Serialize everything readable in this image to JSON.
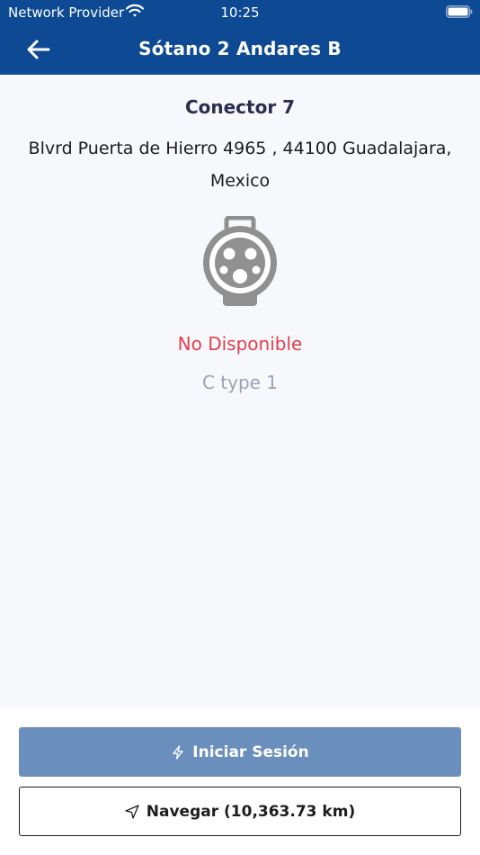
{
  "status_bar": {
    "carrier": "Network Provider",
    "time": "10:25"
  },
  "header": {
    "title": "Sótano 2 Andares B"
  },
  "connector": {
    "title": "Conector 7",
    "address": "Blvrd Puerta de Hierro 4965 , 44100 Guadalajara, Mexico",
    "status": "No Disponible",
    "type": "C type 1",
    "status_color": "#e0404f",
    "icon": "type1-plug-icon"
  },
  "actions": {
    "start_session": "Iniciar Sesión",
    "navigate": "Navegar (10,363.73 km)"
  },
  "colors": {
    "header_bg": "#0d4a93",
    "primary_button": "#6a8fbd"
  }
}
